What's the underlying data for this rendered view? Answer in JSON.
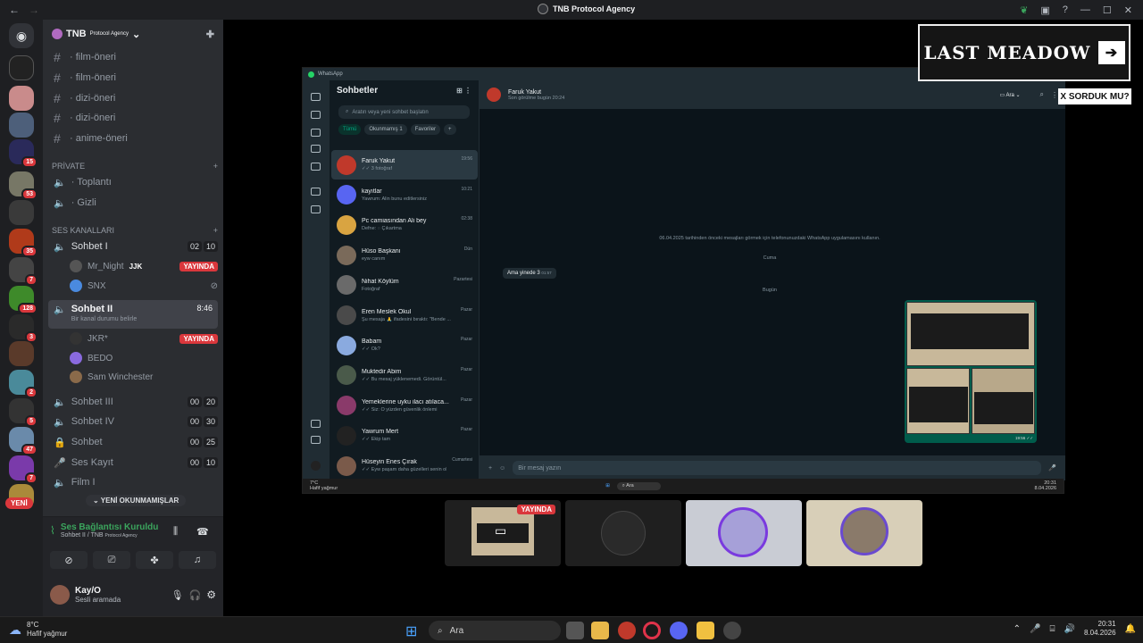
{
  "app_title": "TNB Protocol Agency",
  "server": {
    "name": "TNB",
    "subtitle": "Protocol Agency"
  },
  "channels_top": [
    {
      "label": "· film-öneri"
    },
    {
      "label": "· film-öneri"
    },
    {
      "label": "· dizi-öneri"
    },
    {
      "label": "· dizi-öneri"
    },
    {
      "label": "· anime-öneri"
    }
  ],
  "cat_private": "PRİVATE",
  "private_channels": [
    {
      "label": "· Toplantı"
    },
    {
      "label": "· Gizli"
    }
  ],
  "cat_voice": "SES KANALLARI",
  "voice": {
    "sohbet1": {
      "label": "Sohbet I",
      "c1": "02",
      "c2": "10"
    },
    "users1": [
      {
        "name": "Mr_Night",
        "tag": "JJK",
        "live": "YAYINDA"
      },
      {
        "name": "SNX"
      }
    ],
    "sohbet2": {
      "label": "Sohbet II",
      "time": "8:46",
      "status": "Bir kanal durumu belirle"
    },
    "users2": [
      {
        "name": "JKR*",
        "live": "YAYINDA"
      },
      {
        "name": "BEDO"
      },
      {
        "name": "Sam Winchester"
      }
    ],
    "others": [
      {
        "label": "Sohbet III",
        "c1": "00",
        "c2": "20"
      },
      {
        "label": "Sohbet IV",
        "c1": "00",
        "c2": "30"
      },
      {
        "label": "Sohbet",
        "c1": "00",
        "c2": "25"
      },
      {
        "label": "Ses Kayıt",
        "c1": "00",
        "c2": "10"
      },
      {
        "label": "Film I"
      }
    ]
  },
  "new_unread": "YENİ OKUNMAMIŞLAR",
  "new_badge": "YENİ",
  "server_badges": [
    "15",
    "53",
    "35",
    "7",
    "128",
    "3",
    "2",
    "5",
    "47",
    "7"
  ],
  "voice_panel": {
    "status": "Ses Bağlantısı Kuruldu",
    "channel": "Sohbet II / TNB",
    "channel_sub": "Protocol Agency"
  },
  "user": {
    "name": "Kay/O",
    "status": "Sesli aramada"
  },
  "whatsapp": {
    "title": "WhatsApp",
    "sidebar_title": "Sohbetler",
    "search_placeholder": "Aratın veya yeni sohbet başlatın",
    "filters": [
      "Tümü",
      "Okunmamış 1",
      "Favoriler",
      "+"
    ],
    "chats": [
      {
        "name": "Faruk Yakut",
        "msg": "✓✓ 3 fotoğraf",
        "time": "19:56"
      },
      {
        "name": "kayıtlar",
        "msg": "Yawrum: Alin bunu editlersiniz",
        "time": "10:21"
      },
      {
        "name": "Pc camiasından Ali bey",
        "msg": "Defne: ◌ Çıkartma",
        "time": "02:38"
      },
      {
        "name": "Hüso Başkanı",
        "msg": "eyw canım",
        "time": "Dün"
      },
      {
        "name": "Nihat Köylüm",
        "msg": "Fotoğraf",
        "time": "Pazartesi"
      },
      {
        "name": "Eren Meslek Okul",
        "msg": "Şu mesaja 🙏 ifadesini bıraktı: \"Bende ...",
        "time": "Pazar"
      },
      {
        "name": "Babam",
        "msg": "✓✓ Ok?",
        "time": "Pazar"
      },
      {
        "name": "Muktedir Abim",
        "msg": "✓✓ Bu mesaj yüklenemedi. Görüntül...",
        "time": "Pazar"
      },
      {
        "name": "Yemeklerine uyku ilacı atılaca...",
        "msg": "✓✓ Siz: O yüzden güvenlik önlemi",
        "time": "Pazar"
      },
      {
        "name": "Yawrum Mert",
        "msg": "✓✓ Ekip tam",
        "time": "Pazar"
      },
      {
        "name": "Hüseyin Enes Çırak",
        "msg": "✓✓ Eyw paşam daha güzelleri senin ols...",
        "time": "Cumartesi"
      }
    ],
    "conv_name": "Faruk Yakut",
    "conv_status": "Son görülme bugün 20:24",
    "call_label": "Ara",
    "sys_notice": "06.04.2025 tarihinden önceki mesajları görmek için telefonunuzdaki WhatsApp uygulamasını kullanın.",
    "day1": "Cuma",
    "bubble": "Ama yinede 3",
    "bubble_time": "01:57",
    "day2": "Bugün",
    "img_time": "19:56 ✓✓",
    "compose_placeholder": "Bir mesaj yazın",
    "inner_weather": "7°C",
    "inner_weather_sub": "Hafif yağmur",
    "inner_search": "Ara",
    "inner_time": "20:31",
    "inner_date": "8.04.2026"
  },
  "overlay": {
    "logo_text": "LAST MEADOW",
    "badge": "X SORDUK MU?"
  },
  "tile_live": "YAYINDA",
  "taskbar": {
    "temp": "8°C",
    "weather": "Hafif yağmur",
    "search": "Ara",
    "time": "20:31",
    "date": "8.04.2026"
  }
}
